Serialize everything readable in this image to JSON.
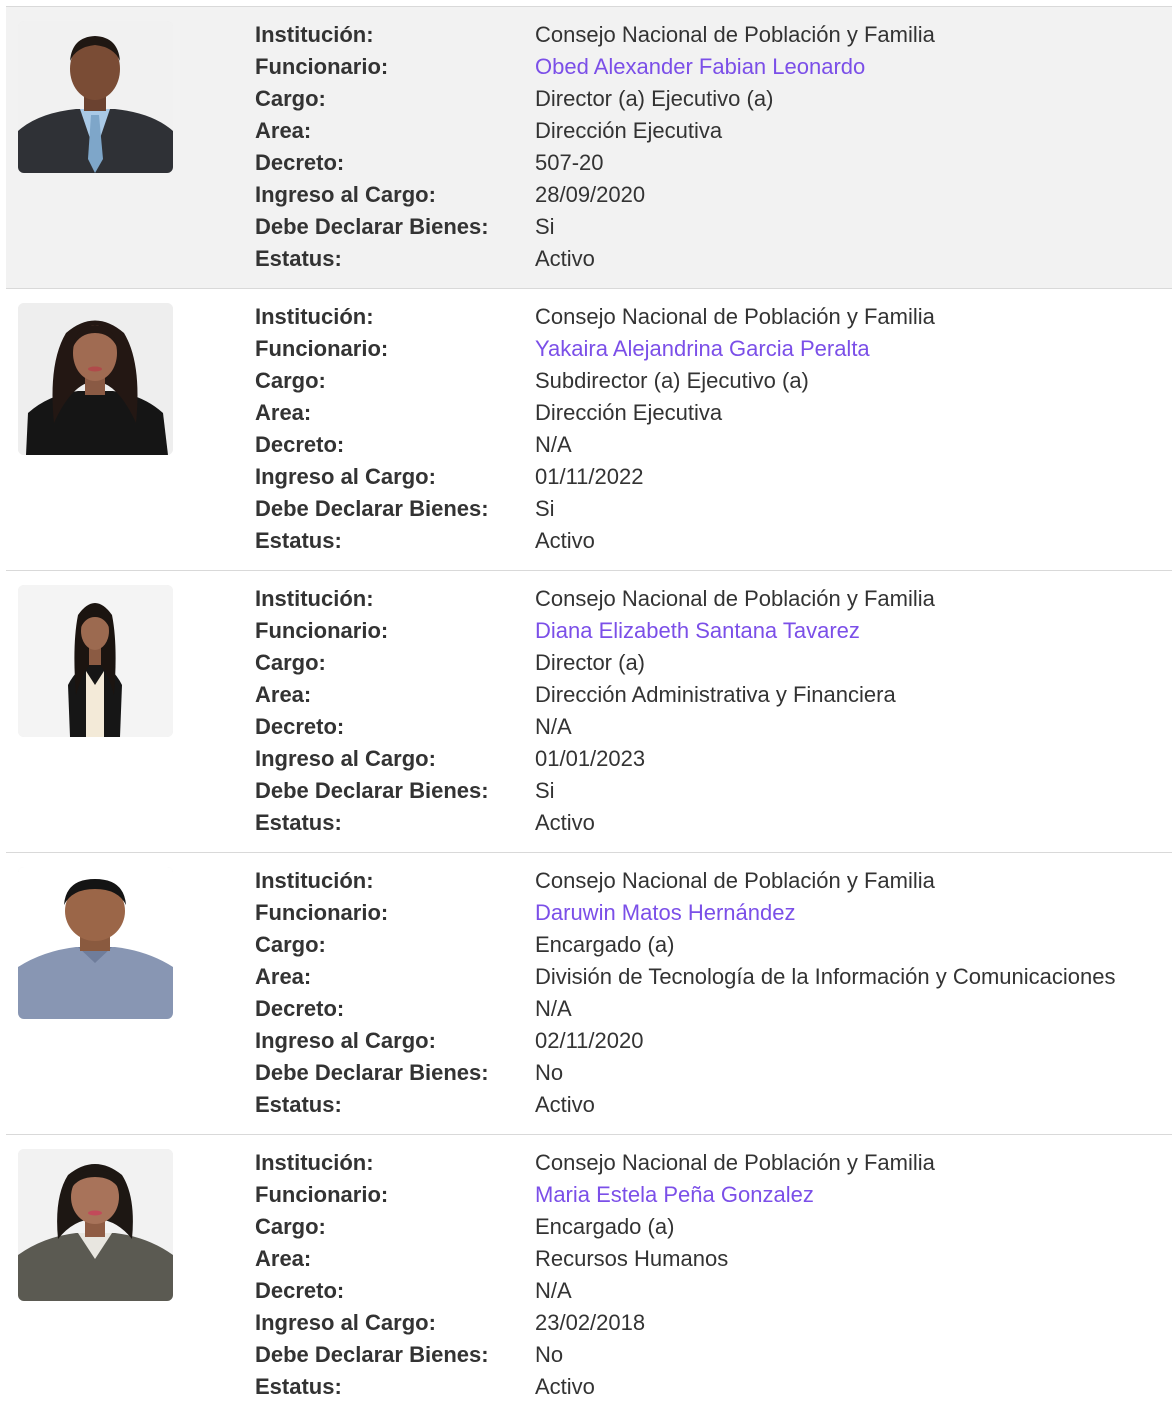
{
  "labels": {
    "institucion": "Institución:",
    "funcionario": "Funcionario:",
    "cargo": "Cargo:",
    "area": "Area:",
    "decreto": "Decreto:",
    "ingreso": "Ingreso al Cargo:",
    "declarar": "Debe Declarar Bienes:",
    "estatus": "Estatus:"
  },
  "colors": {
    "link": "#7b4fe8",
    "highlight_row": "#f2f2f2",
    "divider": "#d9d9d9"
  },
  "records": [
    {
      "institucion": "Consejo Nacional de Población y Familia",
      "funcionario": "Obed Alexander Fabian Leonardo",
      "cargo": "Director (a) Ejecutivo (a)",
      "area": "Dirección Ejecutiva",
      "decreto": "507-20",
      "ingreso": "28/09/2020",
      "declarar": "Si",
      "estatus": "Activo",
      "photo_icon": "person-photo"
    },
    {
      "institucion": "Consejo Nacional de Población y Familia",
      "funcionario": "Yakaira Alejandrina Garcia Peralta",
      "cargo": "Subdirector (a) Ejecutivo (a)",
      "area": "Dirección Ejecutiva",
      "decreto": "N/A",
      "ingreso": "01/11/2022",
      "declarar": "Si",
      "estatus": "Activo",
      "photo_icon": "person-photo"
    },
    {
      "institucion": "Consejo Nacional de Población y Familia",
      "funcionario": "Diana Elizabeth Santana Tavarez",
      "cargo": "Director (a)",
      "area": "Dirección Administrativa y Financiera",
      "decreto": "N/A",
      "ingreso": "01/01/2023",
      "declarar": "Si",
      "estatus": "Activo",
      "photo_icon": "person-photo"
    },
    {
      "institucion": "Consejo Nacional de Población y Familia",
      "funcionario": "Daruwin Matos Hernández",
      "cargo": "Encargado (a)",
      "area": "División de Tecnología de la Información y Comunicaciones",
      "decreto": "N/A",
      "ingreso": "02/11/2020",
      "declarar": "No",
      "estatus": "Activo",
      "photo_icon": "person-photo"
    },
    {
      "institucion": "Consejo Nacional de Población y Familia",
      "funcionario": "Maria Estela Peña Gonzalez",
      "cargo": "Encargado (a)",
      "area": "Recursos Humanos",
      "decreto": "N/A",
      "ingreso": "23/02/2018",
      "declarar": "No",
      "estatus": "Activo",
      "photo_icon": "person-photo"
    }
  ]
}
